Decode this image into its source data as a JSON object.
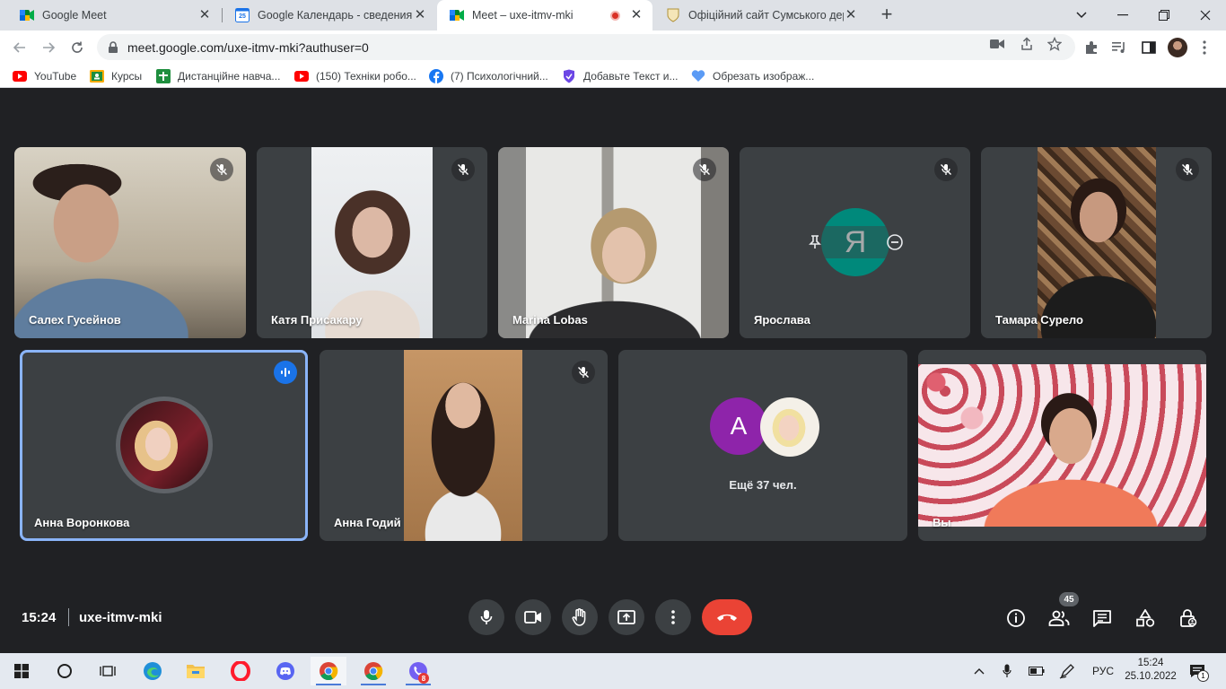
{
  "browser": {
    "tabs": [
      {
        "title": "Google Meet",
        "favicon": "meet-icon",
        "active": false
      },
      {
        "title": "Google Календарь - сведения о",
        "favicon": "calendar-icon",
        "calendar_day": "25",
        "active": false
      },
      {
        "title": "Meet – uxe-itmv-mki",
        "favicon": "meet-icon",
        "active": true,
        "recording": true
      },
      {
        "title": "Офіційний сайт Сумського держ",
        "favicon": "shield-crest-icon",
        "active": false
      }
    ],
    "url": "meet.google.com/uxe-itmv-mki?authuser=0",
    "bookmarks": [
      {
        "label": "YouTube",
        "icon": "youtube-icon"
      },
      {
        "label": "Курсы",
        "icon": "classroom-icon"
      },
      {
        "label": "Дистанційне навча...",
        "icon": "green-cross-icon"
      },
      {
        "label": "(150) Техніки робо...",
        "icon": "youtube-icon"
      },
      {
        "label": "(7) Психологічний...",
        "icon": "facebook-icon"
      },
      {
        "label": "Добавьте Текст и...",
        "icon": "shield-purple-icon"
      },
      {
        "label": "Обрезать изображ...",
        "icon": "heart-blue-icon"
      }
    ]
  },
  "meet": {
    "participants": [
      {
        "name": "Салех Гусейнов",
        "muted": true,
        "type": "video"
      },
      {
        "name": "Катя Присакару",
        "muted": true,
        "type": "video"
      },
      {
        "name": "Marina Lobas",
        "muted": true,
        "type": "video"
      },
      {
        "name": "Ярослава",
        "muted": true,
        "type": "avatar",
        "initial": "Я",
        "avatar_color": "#00897b"
      },
      {
        "name": "Тамара Сурело",
        "muted": true,
        "type": "video"
      },
      {
        "name": "Анна Воронкова",
        "muted": false,
        "speaking": true,
        "type": "photo-avatar"
      },
      {
        "name": "Анна Годий",
        "muted": true,
        "type": "video"
      },
      {
        "name": "Вы",
        "muted": false,
        "type": "video"
      }
    ],
    "more": {
      "label": "Ещё 37 чел.",
      "initial": "A",
      "avatar_color": "#8e24aa"
    },
    "time": "15:24",
    "meeting_code": "uxe-itmv-mki",
    "participant_count": "45"
  },
  "taskbar": {
    "language": "РУС",
    "time": "15:24",
    "date": "25.10.2022",
    "viber_badge": "8",
    "notification_count": "1"
  },
  "colors": {
    "meet_background": "#202124",
    "tile_background": "#3c4043",
    "speaking_outline": "#8ab4f8",
    "leave_button": "#ea4335",
    "taskbar": "#e4e9f0"
  }
}
